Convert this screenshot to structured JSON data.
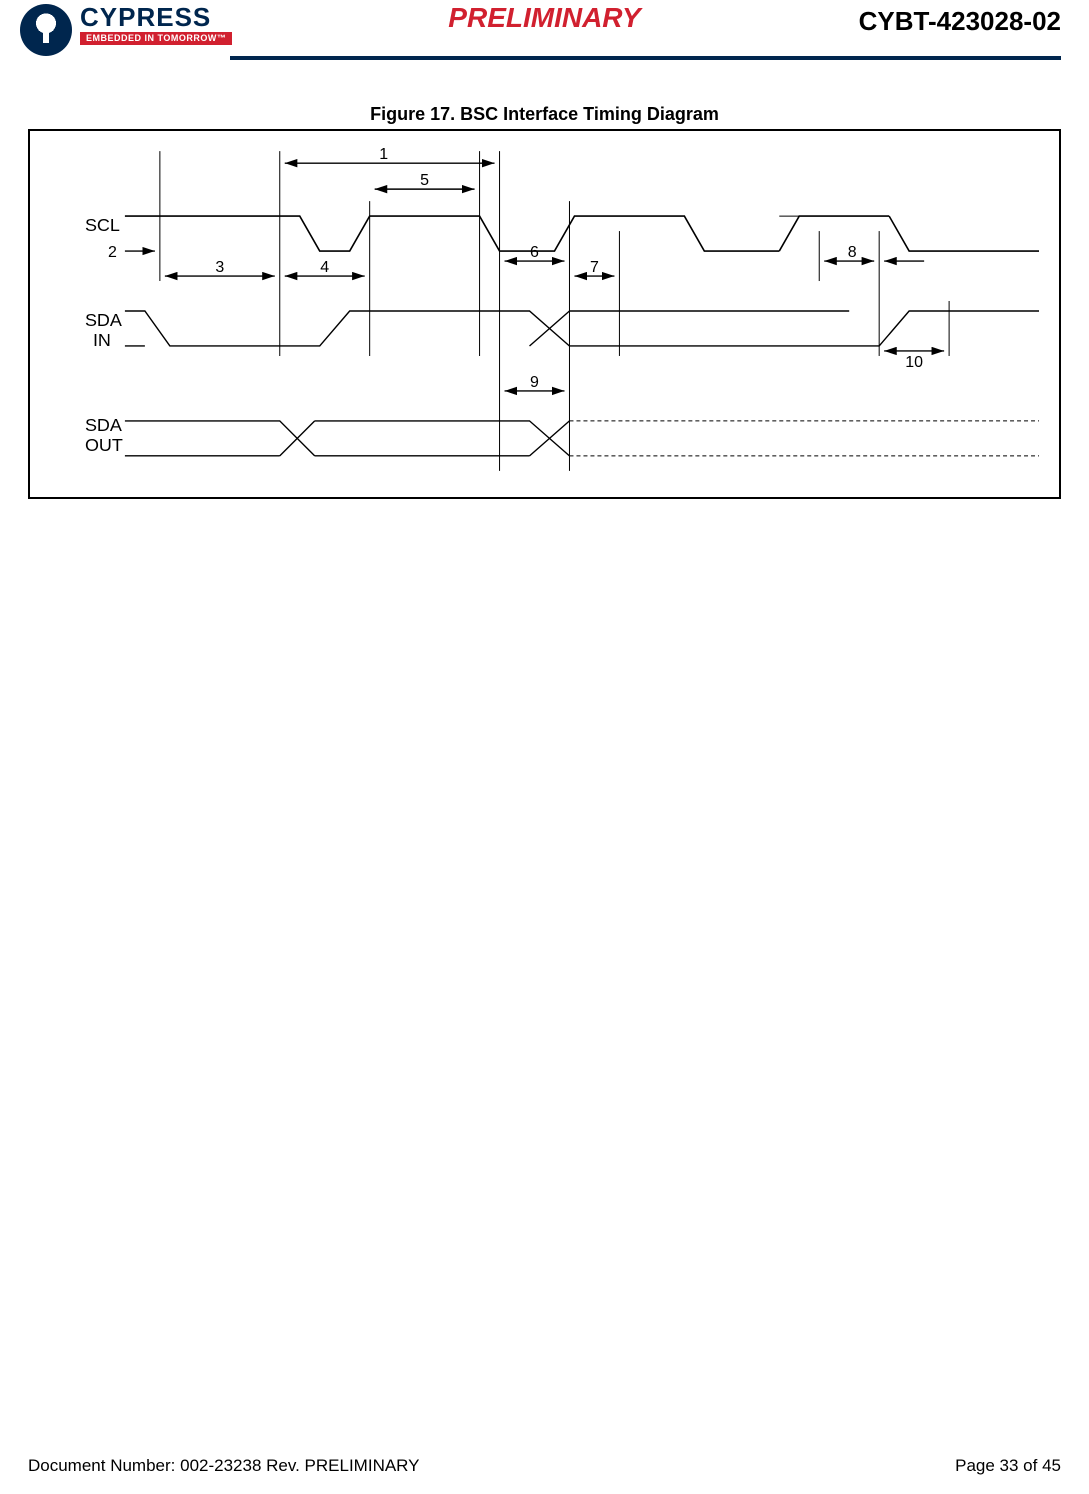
{
  "header": {
    "brand_word": "CYPRESS",
    "brand_tag": "EMBEDDED IN TOMORROW™",
    "preliminary": "PRELIMINARY",
    "part_number": "CYBT-423028-02"
  },
  "figure": {
    "caption": "Figure 17.  BSC Interface Timing Diagram",
    "labels": {
      "scl": "SCL",
      "sda_in_1": "SDA",
      "sda_in_2": "IN",
      "sda_out_1": "SDA",
      "sda_out_2": "OUT"
    },
    "markers": {
      "m1": "1",
      "m2": "2",
      "m3": "3",
      "m4": "4",
      "m5": "5",
      "m6": "6",
      "m7": "7",
      "m8": "8",
      "m9": "9",
      "m10": "10"
    }
  },
  "footer": {
    "doc": "Document Number: 002-23238 Rev. PRELIMINARY",
    "page": "Page 33 of 45"
  },
  "chart_data": {
    "type": "timing-diagram",
    "signals": [
      "SCL",
      "SDA IN",
      "SDA OUT"
    ],
    "dimension_markers": [
      1,
      2,
      3,
      4,
      5,
      6,
      7,
      8,
      9,
      10
    ],
    "title": "BSC Interface Timing Diagram"
  }
}
